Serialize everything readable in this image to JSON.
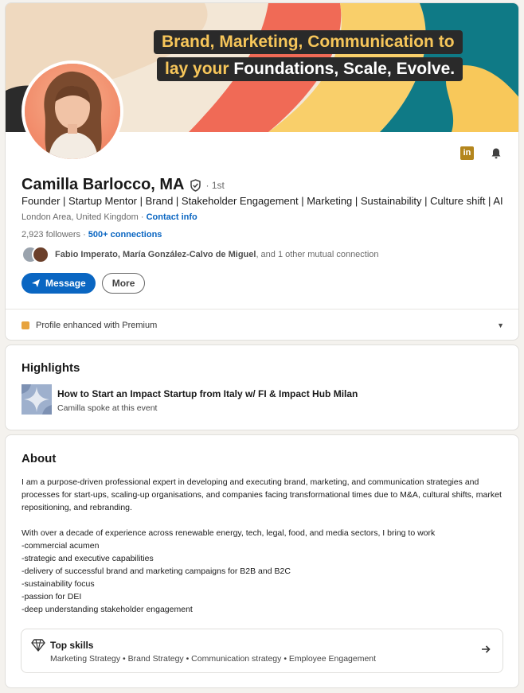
{
  "banner": {
    "line1": "Brand, Marketing, Communication to",
    "line2_highlight": "lay your",
    "line2_rest": " Foundations, Scale, Evolve."
  },
  "profile": {
    "name": "Camilla Barlocco, MA",
    "degree": "· 1st",
    "headline": "Founder | Startup Mentor | Brand | Stakeholder Engagement | Marketing | Sustainability | Culture shift | AI",
    "location": "London Area, United Kingdom",
    "contact_info": "Contact info",
    "followers": "2,923 followers",
    "connections": "500+ connections",
    "mutual_names": "Fabio Imperato, María González-Calvo de Miguel",
    "mutual_rest": ", and 1 other mutual connection",
    "icons": [
      "linkedin-icon",
      "bell-icon",
      "verified-shield-icon"
    ]
  },
  "actions": {
    "message_label": "Message",
    "more_label": "More"
  },
  "premium": {
    "label": "Profile enhanced with Premium"
  },
  "highlights": {
    "title": "Highlights",
    "item_title": "How to Start an Impact Startup from Italy w/ FI & Impact Hub Milan",
    "item_sub": "Camilla spoke at this event"
  },
  "about": {
    "title": "About",
    "paragraph1": "I am a purpose-driven professional expert in developing and executing brand, marketing, and communication strategies and processes for start-ups, scaling-up organisations, and companies facing transformational times due to M&A, cultural shifts, market repositioning, and rebranding.",
    "paragraph2_lines": [
      "With over a decade of experience across renewable energy, tech, legal, food, and media sectors, I bring to work",
      "-commercial acumen",
      "-strategic and executive capabilities",
      "-delivery of successful brand and marketing campaigns for B2B and B2C",
      "-sustainability focus",
      "-passion for DEI",
      "-deep understanding stakeholder engagement"
    ]
  },
  "top_skills": {
    "title": "Top skills",
    "list": "Marketing Strategy • Brand Strategy • Communication strategy • Employee Engagement"
  },
  "colors": {
    "accent": "#0a66c2",
    "page_bg": "#f4f2ee",
    "premium_gold": "#e7a33e",
    "linkedin_gold": "#b4861d"
  }
}
